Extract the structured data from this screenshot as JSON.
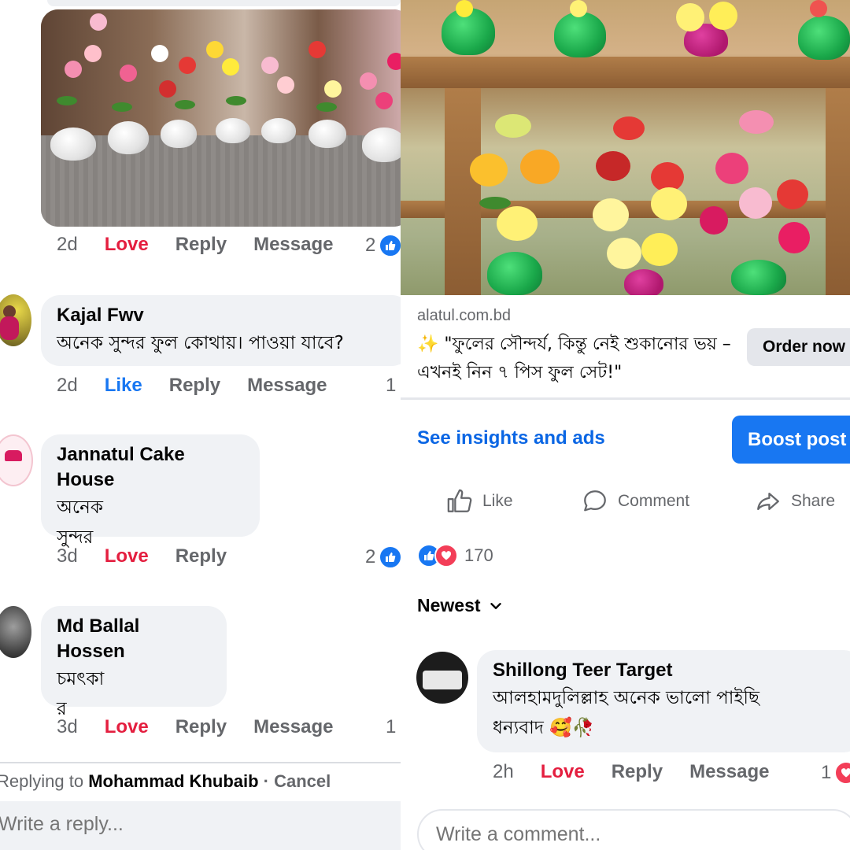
{
  "left": {
    "top_comment_meta": {
      "time": "2d",
      "reaction": "Love",
      "reply": "Reply",
      "message": "Message",
      "count": "2"
    },
    "comments": [
      {
        "name": "Kajal Fwv",
        "text": "অনেক সুন্দর  ফুল কোথায়। পাওয়া যাবে?",
        "time": "2d",
        "reaction": "Like",
        "reply": "Reply",
        "message": "Message",
        "count": "1"
      },
      {
        "name": "Jannatul Cake House",
        "text_line1": "অনেক",
        "text_line2": "সুন্দর",
        "time": "3d",
        "reaction": "Love",
        "reply": "Reply",
        "count": "2"
      },
      {
        "name": "Md Ballal Hossen",
        "text_line1": "চমৎকা",
        "text_line2": "র",
        "time": "3d",
        "reaction": "Love",
        "reply": "Reply",
        "message": "Message",
        "count": "1"
      }
    ],
    "replying": {
      "prefix": "Replying to",
      "name": "Mohammad Khubaib",
      "cancel": "· Cancel"
    },
    "reply_placeholder": "Write a reply..."
  },
  "right": {
    "ad": {
      "url": "alatul.com.bd",
      "text": "✨ \"ফুলের সৌন্দর্য, কিন্তু নেই শুকানোর ভয় – এখনই নিন ৭ পিস ফুল সেট!\"",
      "cta": "Order now"
    },
    "insights_link": "See insights and ads",
    "boost_button": "Boost post",
    "actions": {
      "like": "Like",
      "comment": "Comment",
      "share": "Share"
    },
    "reaction_count": "170",
    "sort_label": "Newest",
    "comment": {
      "name": "Shillong Teer Target",
      "text_line1": "আলহামদুলিল্লাহ অনেক ভালো পাইছি",
      "text_line2": "ধন্যবাদ 🥰🥀",
      "time": "2h",
      "reaction": "Love",
      "reply": "Reply",
      "message": "Message",
      "count": "1"
    },
    "comment_placeholder": "Write a comment..."
  },
  "colors": {
    "facebook_blue": "#1877f2",
    "love_red": "#e41e3f",
    "bubble_grey": "#f0f2f5",
    "meta_grey": "#65676b"
  }
}
